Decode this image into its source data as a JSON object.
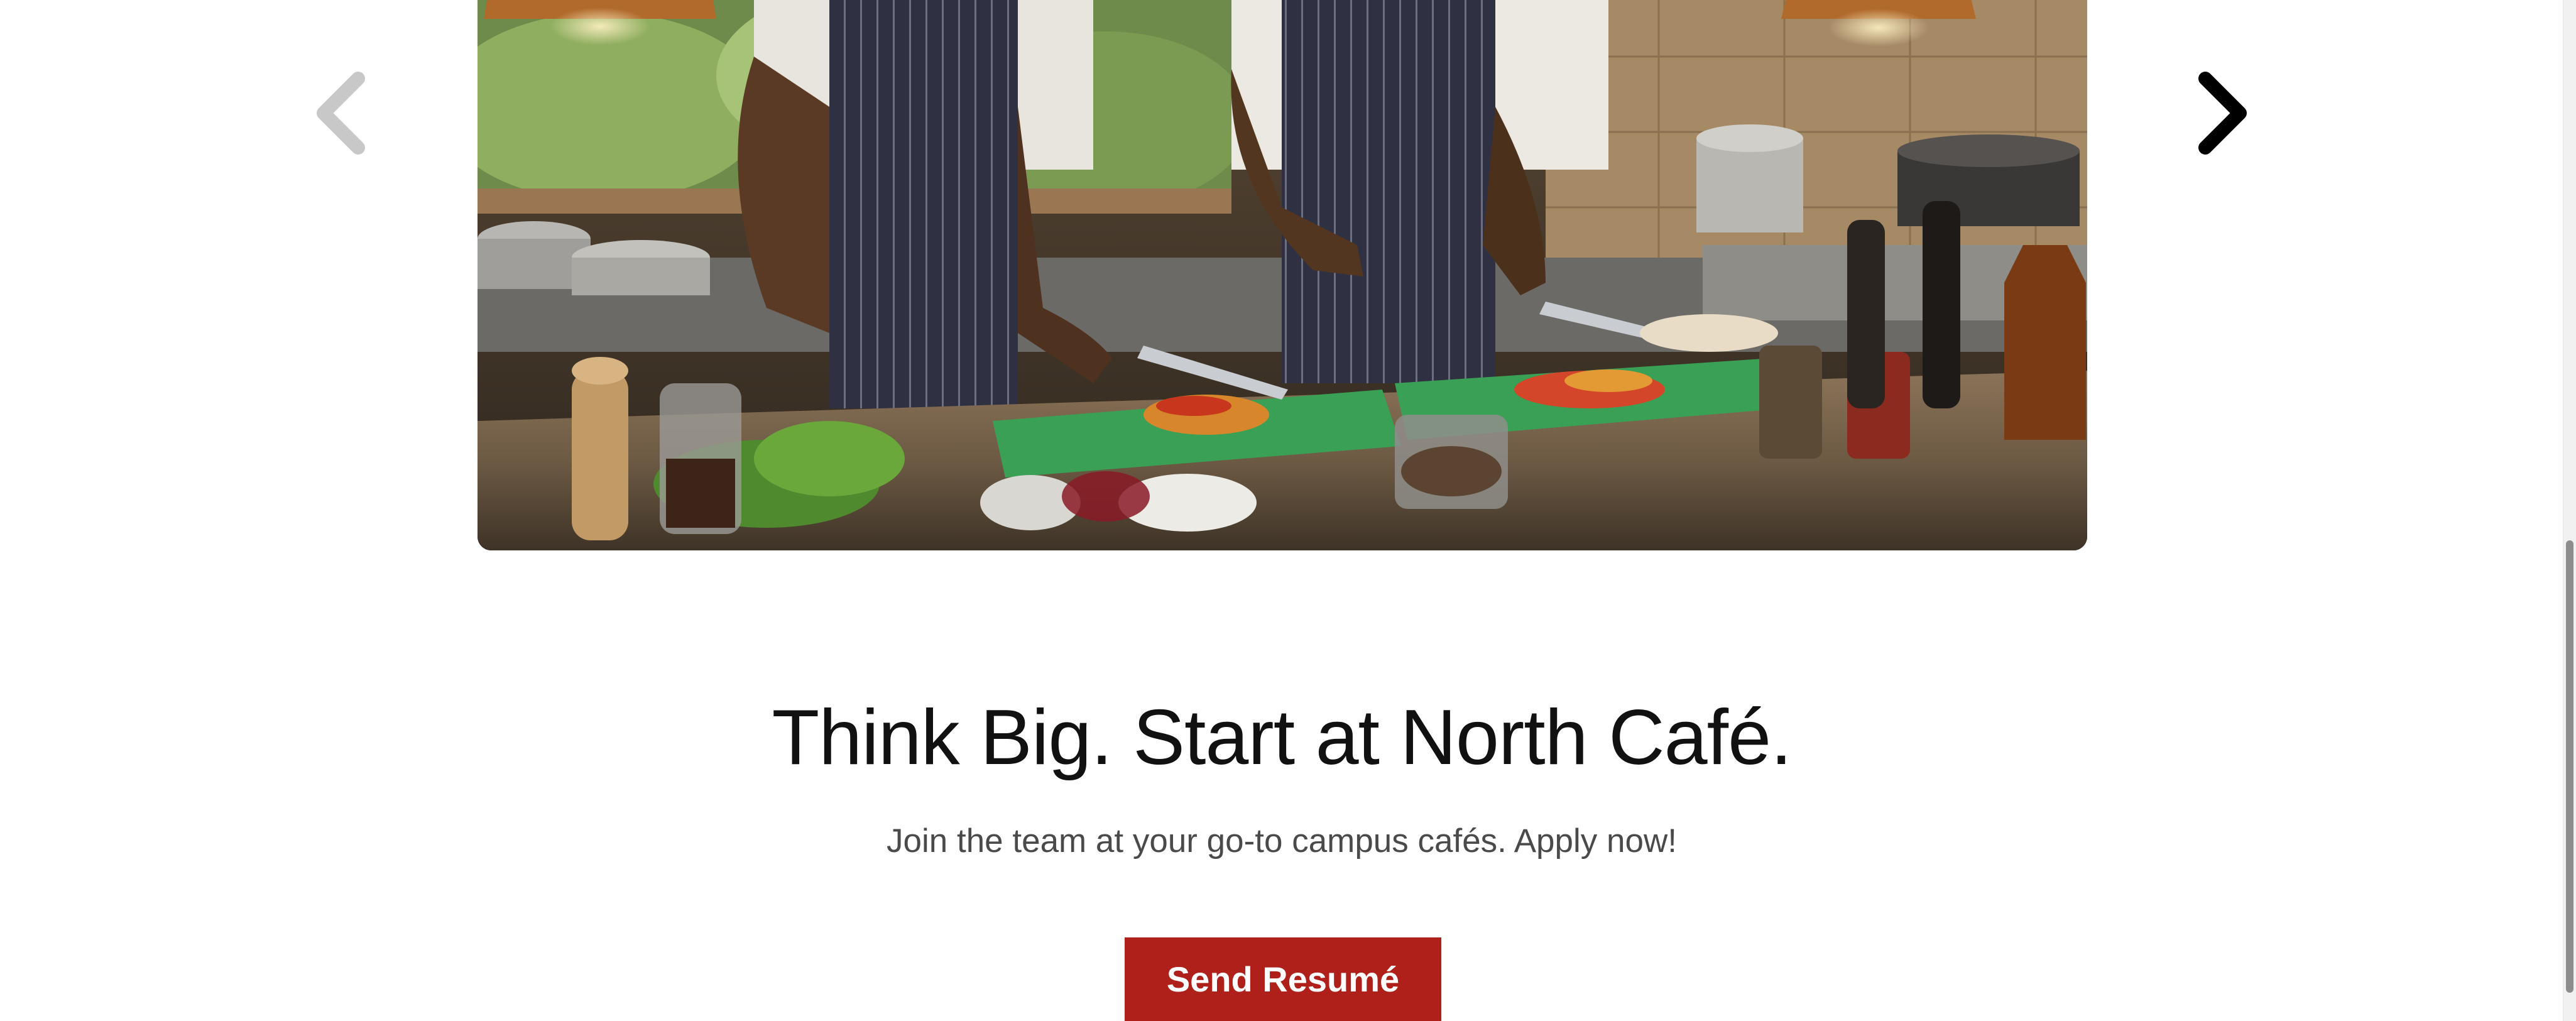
{
  "carousel": {
    "slide_alt": "Two chefs chopping vegetables in a restaurant kitchen",
    "prev_icon": "chevron-left-icon",
    "next_icon": "chevron-right-icon"
  },
  "cta": {
    "title": "Think Big. Start at North Café.",
    "subtitle": "Join the team at your go-to campus cafés. Apply now!",
    "button_label": "Send Resumé"
  },
  "colors": {
    "button_bg": "#b0201a",
    "button_text": "#ffffff",
    "title_text": "#111111",
    "subtitle_text": "#4a4a4a",
    "prev_arrow": "#c8c8c8",
    "next_arrow": "#000000"
  }
}
